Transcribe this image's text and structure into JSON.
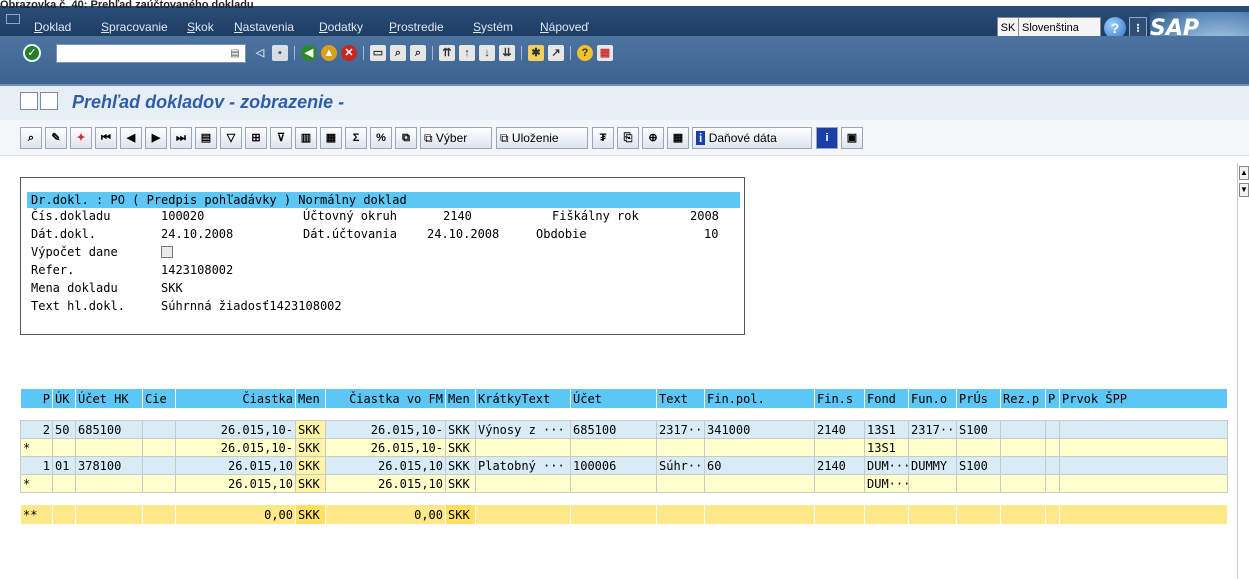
{
  "caption": "Obrazovka č. 40: Prehľad zaúčtovaného dokladu",
  "menu": {
    "items": [
      "Doklad",
      "Spracovanie",
      "Skok",
      "Nastavenia",
      "Dodatky",
      "Prostredie",
      "Systém",
      "Nápoveď"
    ]
  },
  "lang": {
    "code": "SK",
    "name": "Slovenština"
  },
  "brand": {
    "logo": "SAP"
  },
  "toolbar1": {
    "icons": [
      "ok-icon",
      "back-icon",
      "save-icon",
      "back-green-icon",
      "exit-icon",
      "cancel-icon",
      "print-icon",
      "find-icon",
      "find-next-icon",
      "first-page-icon",
      "prev-page-icon",
      "next-page-icon",
      "last-page-icon",
      "create-session-icon",
      "shortcut-icon",
      "help-icon",
      "layout-icon"
    ]
  },
  "page": {
    "title": "Prehľad dokladov - zobrazenie -"
  },
  "toolbar2": {
    "vyber": "Výber",
    "ulozenie": "Uloženie",
    "danove_data": "Daňové dáta"
  },
  "header": {
    "title": "Dr.dokl. : PO ( Predpis pohľadávky ) Normálny doklad",
    "cis_label": "Čís.dokladu",
    "cis_value": "100020",
    "okruh_label": "Účtovný okruh",
    "okruh_value": "2140",
    "rok_label": "Fiškálny rok",
    "rok_value": "2008",
    "datdokl_label": "Dát.dokl.",
    "datdokl_value": "24.10.2008",
    "datuct_label": "Dát.účtovania",
    "datuct_value": "24.10.2008",
    "obdobie_label": "Obdobie",
    "obdobie_value": "10",
    "vypocet_label": "Výpočet dane",
    "refer_label": "Refer.",
    "refer_value": "1423108002",
    "mena_label": "Mena dokladu",
    "mena_value": "SKK",
    "text_label": "Text hl.dokl.",
    "text_value": "Súhrnná žiadosť1423108002"
  },
  "grid": {
    "columns": [
      "P",
      "ÚK",
      "Účet HK",
      "Cie",
      "Čiastka",
      "Men",
      "Čiastka vo FM",
      "Men",
      "KrátkyText",
      "Účet",
      "Text",
      "Fin.pol.",
      "Fin.s",
      "Fond",
      "Fun.o",
      "PrÚs",
      "Rez.p",
      "P",
      "Prvok ŠPP"
    ],
    "rows": [
      [
        "2",
        "50",
        "685100",
        "",
        "26.015,10-",
        "SKK",
        "26.015,10-",
        "SKK",
        "Výnosy z ···",
        "685100",
        "2317···",
        "341000",
        "2140",
        "13S1",
        "2317···",
        "S100",
        "",
        "",
        ""
      ],
      [
        "*",
        "",
        "",
        "",
        "26.015,10-",
        "SKK",
        "26.015,10-",
        "SKK",
        "",
        "",
        "",
        "",
        "",
        "13S1",
        "",
        "",
        "",
        "",
        ""
      ],
      [
        "1",
        "01",
        "378100",
        "",
        "26.015,10",
        "SKK",
        "26.015,10",
        "SKK",
        "Platobný ···",
        "100006",
        "Súhr···",
        "60",
        "2140",
        "DUM···",
        "DUMMY",
        "S100",
        "",
        "",
        ""
      ],
      [
        "*",
        "",
        "",
        "",
        "26.015,10",
        "SKK",
        "26.015,10",
        "SKK",
        "",
        "",
        "",
        "",
        "",
        "DUM···",
        "",
        "",
        "",
        "",
        ""
      ]
    ],
    "total": [
      "**",
      "",
      "",
      "",
      "0,00",
      "SKK",
      "0,00",
      "SKK",
      "",
      "",
      "",
      "",
      "",
      "",
      "",
      "",
      "",
      "",
      ""
    ]
  }
}
